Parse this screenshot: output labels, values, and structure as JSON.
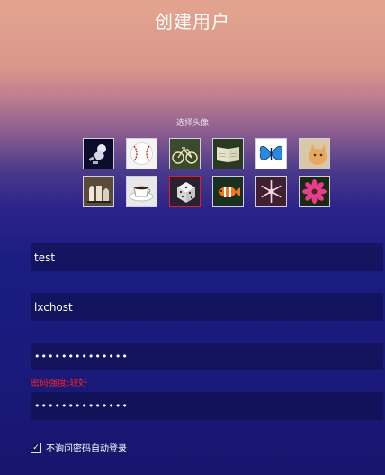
{
  "title": "创建用户",
  "avatar_section": {
    "label": "选择头像",
    "avatars": [
      {
        "icon": "astronaut-icon"
      },
      {
        "icon": "baseball-icon"
      },
      {
        "icon": "bicycle-icon"
      },
      {
        "icon": "book-icon"
      },
      {
        "icon": "butterfly-icon"
      },
      {
        "icon": "cat-icon"
      },
      {
        "icon": "chess-icon"
      },
      {
        "icon": "coffee-icon"
      },
      {
        "icon": "dice-icon",
        "selected": true
      },
      {
        "icon": "fish-icon"
      },
      {
        "icon": "snowflake-icon"
      },
      {
        "icon": "flower-icon"
      }
    ]
  },
  "form": {
    "username": "test",
    "hostname": "lxchost",
    "password": "••••••••••••••",
    "password_strength": "密码强度:较好",
    "confirm_password": "••••••••••••••",
    "auto_login_label": "不询问密码自动登录",
    "auto_login_checked": "✓"
  },
  "colors": {
    "strength_text": "#ff2020",
    "selected_border": "#e02020"
  }
}
